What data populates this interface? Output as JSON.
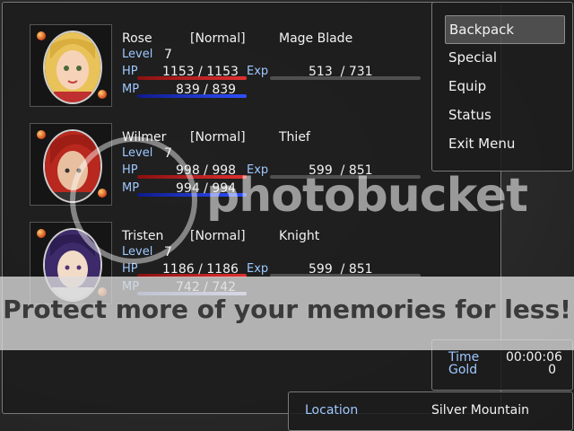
{
  "actors": [
    {
      "name": "Rose",
      "state": "[Normal]",
      "class": "Mage Blade",
      "level_label": "Level",
      "level": "7",
      "hp_label": "HP",
      "hp": "1153",
      "hp_max": "1153",
      "mp_label": "MP",
      "mp": "839",
      "mp_max": "839",
      "exp_label": "Exp",
      "exp": "513",
      "exp_next": "731",
      "hair": "#e9c35a",
      "skin": "#f6d3b8",
      "outfit": "#c03030"
    },
    {
      "name": "Wilmer",
      "state": "[Normal]",
      "class": "Thief",
      "level_label": "Level",
      "level": "7",
      "hp_label": "HP",
      "hp": "998",
      "hp_max": "998",
      "mp_label": "MP",
      "mp": "994",
      "mp_max": "994",
      "exp_label": "Exp",
      "exp": "599",
      "exp_next": "851",
      "hair": "#b8281e",
      "skin": "#e8c0a0",
      "outfit": "#333333"
    },
    {
      "name": "Tristen",
      "state": "[Normal]",
      "class": "Knight",
      "level_label": "Level",
      "level": "7",
      "hp_label": "HP",
      "hp": "1186",
      "hp_max": "1186",
      "mp_label": "MP",
      "mp": "742",
      "mp_max": "742",
      "exp_label": "Exp",
      "exp": "599",
      "exp_next": "851",
      "hair": "#3d2a6a",
      "skin": "#f2dcc8",
      "outfit": "#dcdcdc"
    }
  ],
  "menu": {
    "items": [
      "Backpack",
      "Special",
      "Equip",
      "Status",
      "Exit Menu"
    ],
    "selected": 0
  },
  "stats": {
    "time_label": "Time",
    "time": "00:00:06",
    "gold_label": "Gold",
    "gold": "0"
  },
  "location": {
    "label": "Location",
    "value": "Silver Mountain"
  },
  "watermark": {
    "logo": "photobucket",
    "tagline": "Protect more of your memories for less!"
  }
}
